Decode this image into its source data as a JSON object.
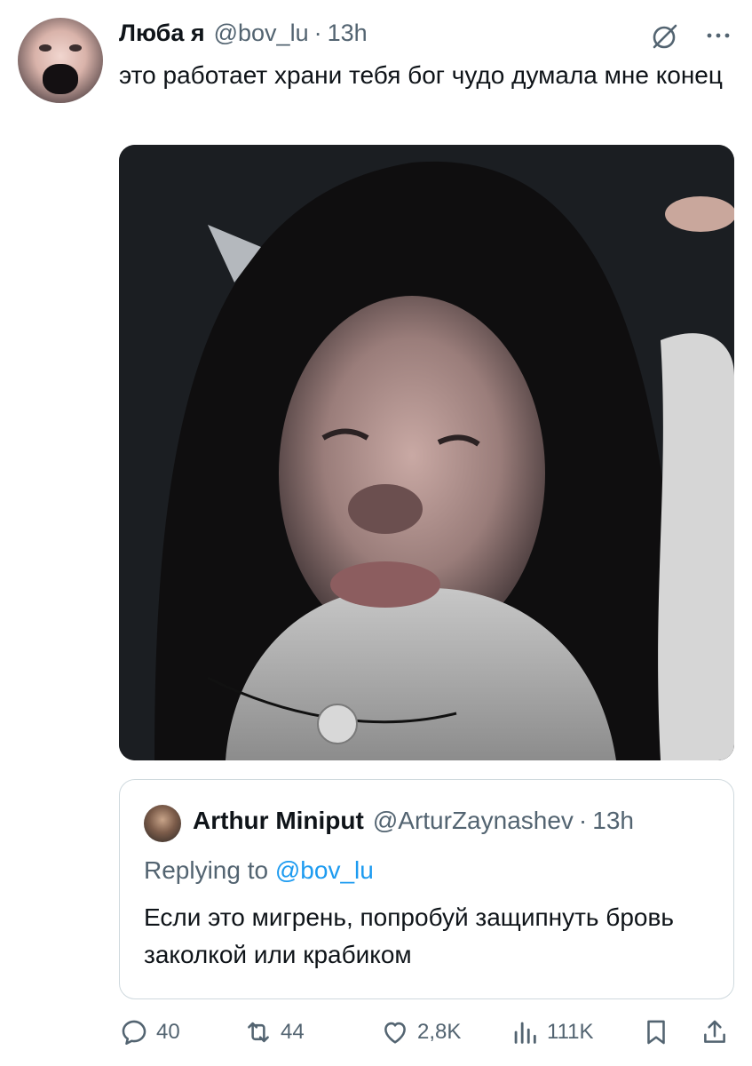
{
  "tweet": {
    "author_name": "Люба я",
    "handle": "@bov_lu",
    "separator": "·",
    "time": "13h",
    "text": "это работает храни тебя бог чудо думала мне конец"
  },
  "icons": {
    "grok": "grok-icon",
    "more": "more-icon",
    "reply": "reply-icon",
    "retweet": "retweet-icon",
    "like": "heart-icon",
    "views": "views-icon",
    "bookmark": "bookmark-icon",
    "share": "share-icon"
  },
  "quote": {
    "author_name": "Arthur Miniput",
    "handle": "@ArturZaynashev",
    "separator": "·",
    "time": "13h",
    "replying_prefix": "Replying to",
    "replying_handle": "@bov_lu",
    "text": "Если это мигрень, попробуй защипнуть бровь заколкой или крабиком"
  },
  "actions": {
    "replies": "40",
    "retweets": "44",
    "likes": "2,8K",
    "views": "111K"
  },
  "colors": {
    "text": "#0f1419",
    "secondary": "#536471",
    "link": "#1d9bf0",
    "border": "#cfd9de"
  }
}
